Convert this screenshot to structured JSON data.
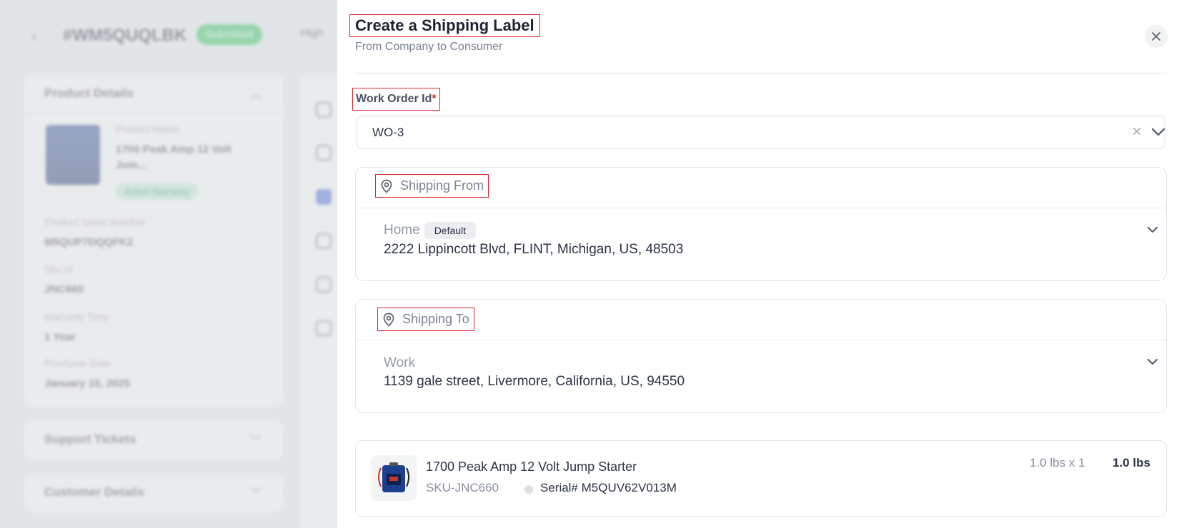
{
  "background": {
    "order_id": "#WM5QUQLBK",
    "status_badge": "Submitted",
    "priority": "High",
    "product_details": {
      "heading": "Product Details",
      "product_name_label": "Product Name",
      "product_name": "1700 Peak Amp 12 Volt Jum...",
      "warranty_badge": "Active Warranty",
      "serial_label": "Product Serial Number",
      "serial": "M5QUP7DQQFK2",
      "sku_label": "Sku Id",
      "sku": "JNC660",
      "warranty_time_label": "Warranty Time",
      "warranty_time": "1 Year",
      "purchase_date_label": "Purchase Date",
      "purchase_date": "January 10, 2025"
    },
    "support_tickets": "Support Tickets",
    "customer_details": "Customer Details"
  },
  "drawer": {
    "title": "Create a Shipping Label",
    "subtitle": "From Company to Consumer",
    "work_order_label": "Work Order Id",
    "required_mark": "*",
    "work_order_value": "WO-3",
    "shipping_from": {
      "heading": "Shipping From",
      "address_name": "Home",
      "default_tag": "Default",
      "address_line": "2222 Lippincott Blvd, FLINT, Michigan, US, 48503"
    },
    "shipping_to": {
      "heading": "Shipping To",
      "address_name": "Work",
      "address_line": "1139 gale street, Livermore, California, US, 94550"
    },
    "item": {
      "name": "1700 Peak Amp 12 Volt Jump Starter",
      "sku": "SKU-JNC660",
      "serial": "Serial# M5QUV62V013M",
      "weight_per_qty": "1.0 lbs x 1",
      "total_weight": "1.0 lbs"
    }
  },
  "colors": {
    "highlight_box": "#e0242b",
    "status_green": "#19c34a",
    "text_primary": "#2b3445",
    "text_muted": "#7a8294"
  }
}
